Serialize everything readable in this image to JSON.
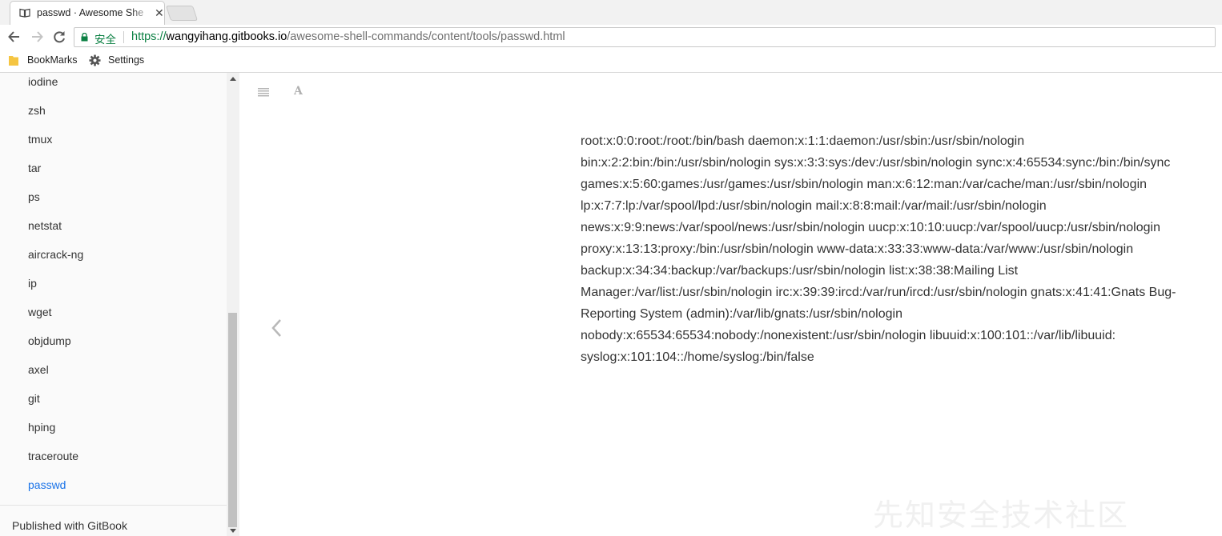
{
  "browser": {
    "tab_title": "passwd · Awesome She",
    "tab_close": "✕",
    "secure_label": "安全",
    "url_scheme": "https://",
    "url_host": "wangyihang.gitbooks.io",
    "url_path": "/awesome-shell-commands/content/tools/passwd.html",
    "bookmarks": [
      "BookMarks",
      "Settings"
    ]
  },
  "sidebar": {
    "items": [
      {
        "label": "iodine"
      },
      {
        "label": "zsh"
      },
      {
        "label": "tmux"
      },
      {
        "label": "tar"
      },
      {
        "label": "ps"
      },
      {
        "label": "netstat"
      },
      {
        "label": "aircrack-ng"
      },
      {
        "label": "ip"
      },
      {
        "label": "wget"
      },
      {
        "label": "objdump"
      },
      {
        "label": "axel"
      },
      {
        "label": "git"
      },
      {
        "label": "hping"
      },
      {
        "label": "traceroute"
      },
      {
        "label": "passwd",
        "active": true
      }
    ],
    "footer": "Published with GitBook"
  },
  "content": {
    "lines": [
      "root:x:0:0:root:/root:/bin/bash daemon:x:1:1:daemon:/usr/sbin:/usr/sbin/nologin",
      "bin:x:2:2:bin:/bin:/usr/sbin/nologin sys:x:3:3:sys:/dev:/usr/sbin/nologin sync:x:4:65534:sync:/bin:/bin/sync",
      "games:x:5:60:games:/usr/games:/usr/sbin/nologin man:x:6:12:man:/var/cache/man:/usr/sbin/nologin",
      "lp:x:7:7:lp:/var/spool/lpd:/usr/sbin/nologin mail:x:8:8:mail:/var/mail:/usr/sbin/nologin",
      "news:x:9:9:news:/var/spool/news:/usr/sbin/nologin uucp:x:10:10:uucp:/var/spool/uucp:/usr/sbin/nologin",
      "proxy:x:13:13:proxy:/bin:/usr/sbin/nologin www-data:x:33:33:www-data:/var/www:/usr/sbin/nologin",
      "backup:x:34:34:backup:/var/backups:/usr/sbin/nologin list:x:38:38:Mailing List",
      "Manager:/var/list:/usr/sbin/nologin irc:x:39:39:ircd:/var/run/ircd:/usr/sbin/nologin gnats:x:41:41:Gnats Bug-",
      "Reporting System (admin):/var/lib/gnats:/usr/sbin/nologin",
      "nobody:x:65534:65534:nobody:/nonexistent:/usr/sbin/nologin libuuid:x:100:101::/var/lib/libuuid:",
      "syslog:x:101:104::/home/syslog:/bin/false"
    ]
  },
  "watermark": "先知安全技术社区",
  "colors": {
    "accent": "#1a73e8",
    "secure_green": "#0b8043",
    "text": "#333333"
  }
}
